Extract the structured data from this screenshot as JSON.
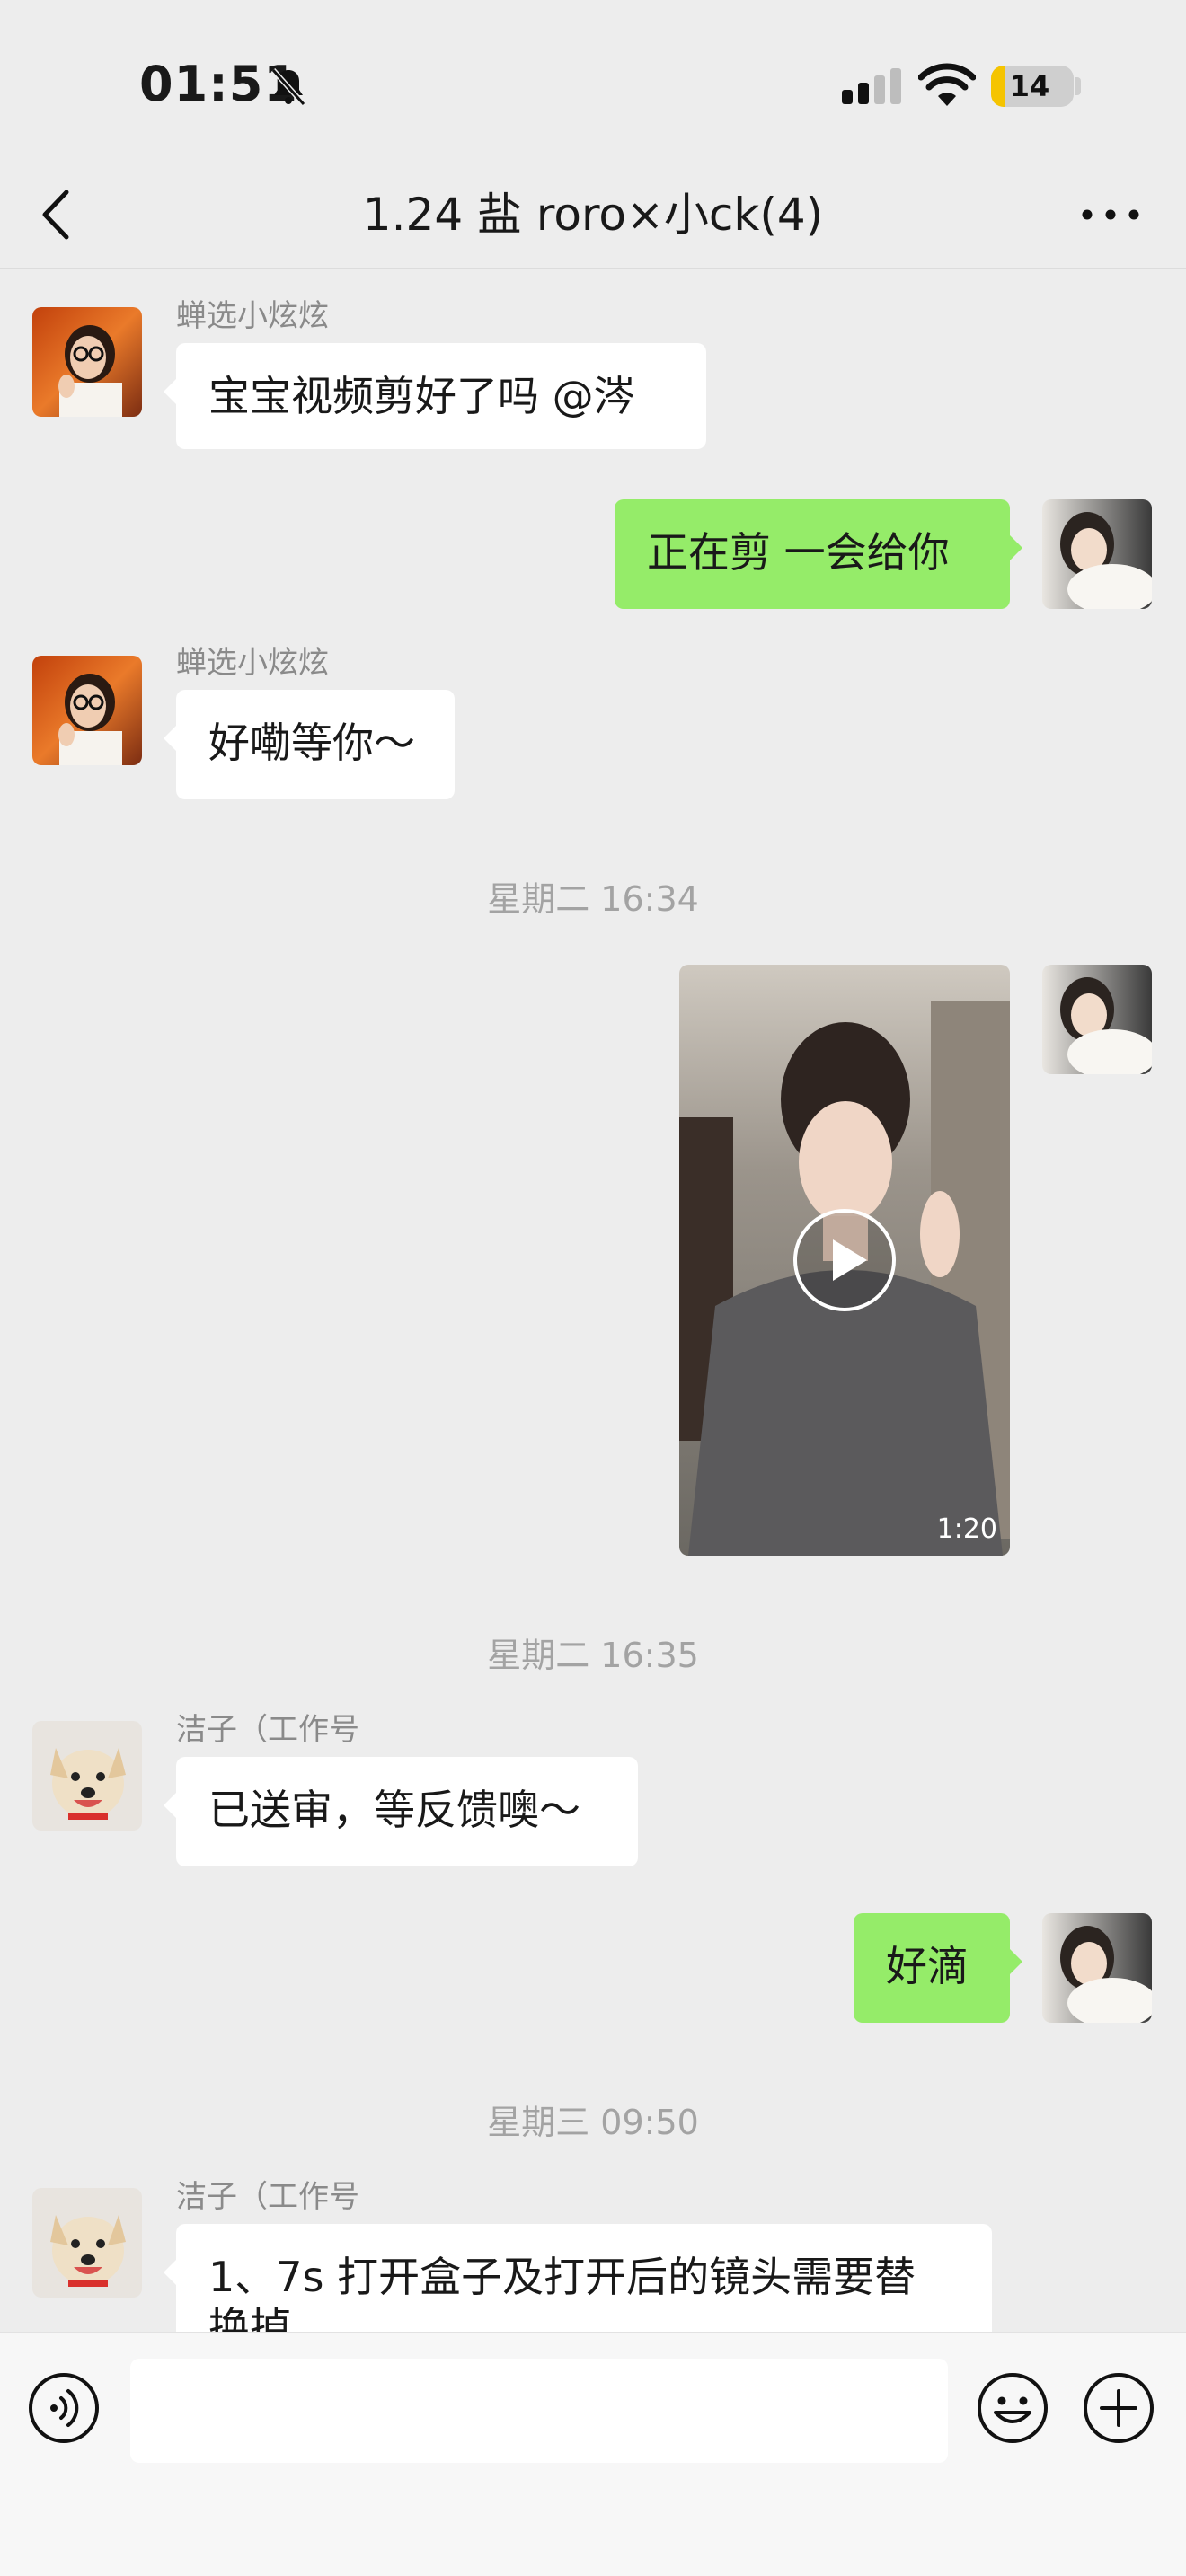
{
  "status_bar": {
    "time": "01:51",
    "battery": "14",
    "icons": [
      "bell-slash-icon",
      "signal-icon",
      "wifi-icon",
      "battery-icon"
    ]
  },
  "nav": {
    "title": "1.24 盐 roro×小ck(4)",
    "icons": [
      "back-chevron-icon",
      "more-icon"
    ]
  },
  "messages": [
    {
      "sender": "蝉选小炫炫",
      "text": "宝宝视频剪好了吗 @涔",
      "direction": "in"
    },
    {
      "sender": "",
      "text": "正在剪 一会给你",
      "direction": "out"
    },
    {
      "sender": "蝉选小炫炫",
      "text": "好嘞等你～",
      "direction": "in"
    },
    {
      "timestamp": "星期二 16:34"
    },
    {
      "sender": "",
      "type": "video",
      "duration": "1:20",
      "direction": "out"
    },
    {
      "timestamp": "星期二 16:35"
    },
    {
      "sender": "洁子（工作号",
      "text": "已送审，等反馈噢～",
      "direction": "in"
    },
    {
      "sender": "",
      "text": "好滴",
      "direction": "out"
    },
    {
      "timestamp": "星期三 09:50"
    },
    {
      "sender": "洁子（工作号",
      "text_line1": "1、7s 打开盒子及打开后的镜头需要替",
      "text_line2": "换掉",
      "direction": "in"
    }
  ],
  "input_bar": {
    "value": "",
    "icons": [
      "voice-icon",
      "emoji-icon",
      "plus-icon"
    ]
  },
  "colors": {
    "background": "#ededed",
    "bubble_out": "#95ec69",
    "bubble_in": "#ffffff",
    "battery_low": "#f5c400"
  }
}
